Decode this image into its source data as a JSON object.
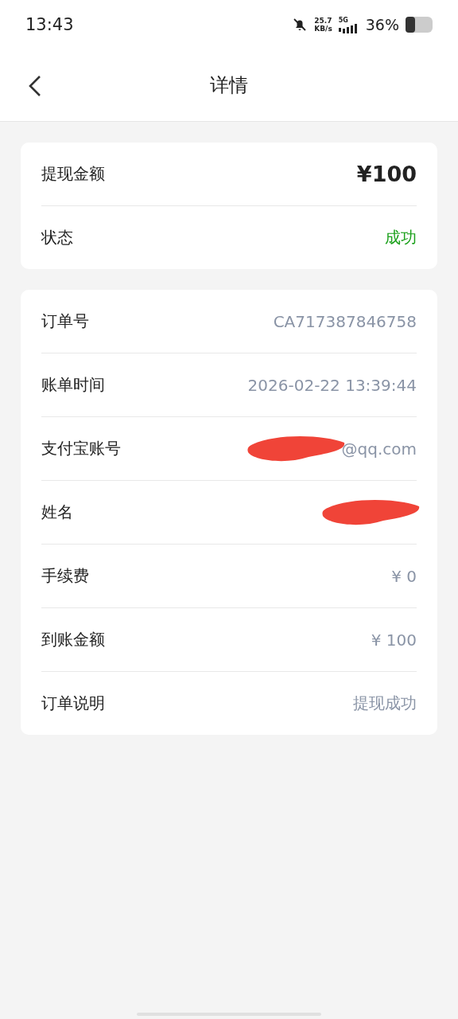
{
  "status_bar": {
    "time": "13:43",
    "speed_value": "25.7",
    "speed_unit": "KB/s",
    "network": "5G",
    "battery": "36%"
  },
  "header": {
    "title": "详情"
  },
  "summary": [
    {
      "label": "提现金额",
      "value": "¥100",
      "kind": "amount"
    },
    {
      "label": "状态",
      "value": "成功",
      "kind": "status"
    }
  ],
  "details": [
    {
      "label": "订单号",
      "value": "CA717387846758",
      "redacted": false
    },
    {
      "label": "账单时间",
      "value": "2026-02-22 13:39:44",
      "redacted": false
    },
    {
      "label": "支付宝账号",
      "value": "@qq.com",
      "redacted": true
    },
    {
      "label": "姓名",
      "redacted": true
    },
    {
      "label": "手续费",
      "value": "¥ 0",
      "redacted": false
    },
    {
      "label": "到账金额",
      "value": "¥ 100",
      "redacted": false
    },
    {
      "label": "订单说明",
      "value": "提现成功",
      "redacted": false
    }
  ]
}
